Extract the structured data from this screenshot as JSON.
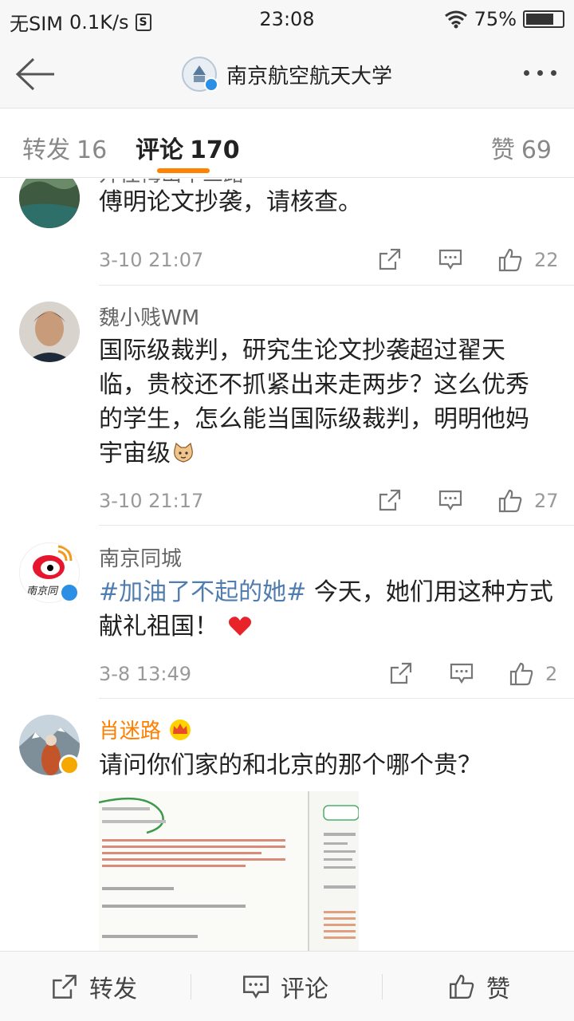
{
  "status_bar": {
    "carrier": "无SIM",
    "speed": "0.1K/s",
    "time": "23:08",
    "battery": "75%"
  },
  "nav": {
    "title": "南京航空航天大学"
  },
  "tabs": {
    "repost_label": "转发",
    "repost_count": "16",
    "comment_label": "评论",
    "comment_count": "170",
    "like_label": "赞",
    "like_count": "69"
  },
  "comments": [
    {
      "name": "开往梅山十三路",
      "text": "傅明论文抄袭，请核查。",
      "time": "3-10 21:07",
      "likes": "22"
    },
    {
      "name": "魏小贱WM",
      "text": "国际级裁判，研究生论文抄袭超过翟天临，贵校还不抓紧出来走两步？这么优秀的学生，怎么能当国际级裁判，明明他妈宇宙级",
      "time": "3-10 21:17",
      "likes": "27"
    },
    {
      "name": "南京同城",
      "topic": "#加油了不起的她#",
      "text": " 今天，她们用这种方式献礼祖国！",
      "time": "3-8 13:49",
      "likes": "2"
    },
    {
      "name": "肖迷路",
      "text": "请问你们家的和北京的那个哪个贵？"
    }
  ],
  "bottom_bar": {
    "repost": "转发",
    "comment": "评论",
    "like": "赞"
  },
  "colors": {
    "accent": "#ff8200",
    "topic": "#507daf",
    "vip_name": "#ff7f00"
  }
}
